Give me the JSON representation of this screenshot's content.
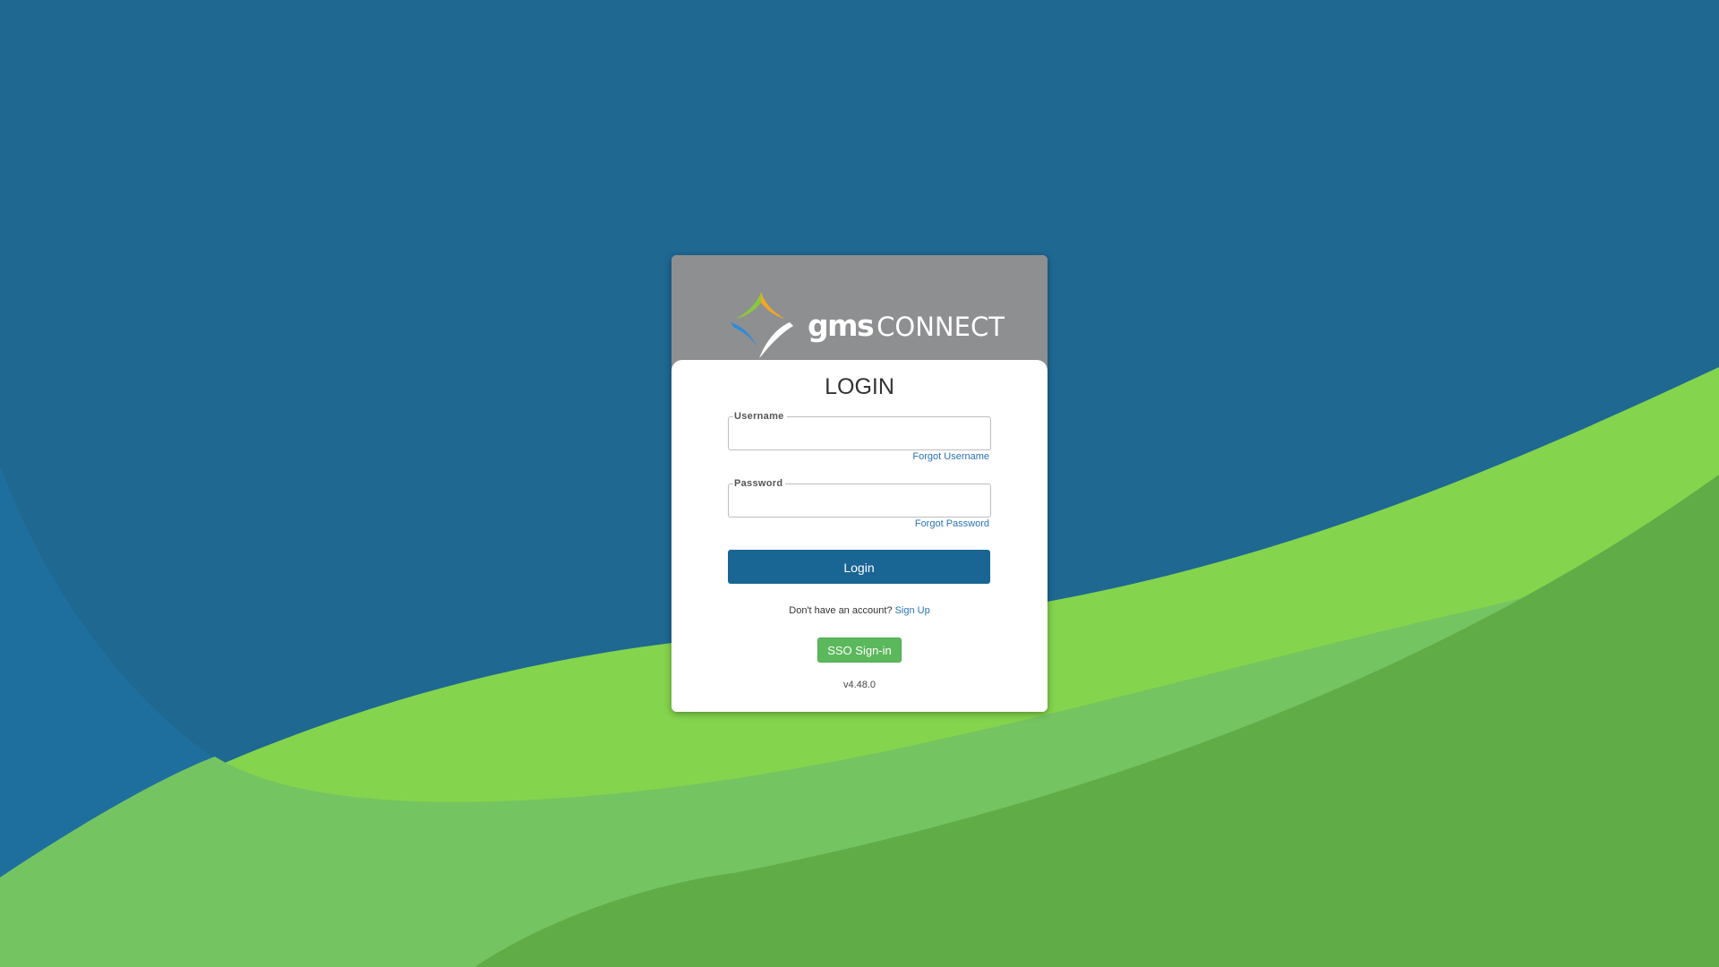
{
  "background": {
    "base_color": "#1e6892",
    "wave_colors": [
      "#1f6f9e",
      "#84d44e",
      "#74c461",
      "#60ac47"
    ]
  },
  "brand": {
    "logo_gms": "gms",
    "logo_connect": "CONNECT",
    "header_color": "#8e8f91",
    "logo_mark_colors": [
      "#f5a623",
      "#8cc63f",
      "#2e8ad8",
      "#ffffff"
    ]
  },
  "login": {
    "title": "LOGIN",
    "username": {
      "label": "Username",
      "value": "",
      "forgot_link": "Forgot Username"
    },
    "password": {
      "label": "Password",
      "value": "",
      "forgot_link": "Forgot Password"
    },
    "login_button": "Login",
    "signup_prompt": "Don't have an account?",
    "signup_link": "Sign Up",
    "sso_button": "SSO Sign-in",
    "version": "v4.48.0",
    "primary_color": "#196593",
    "sso_color": "#5cb85c",
    "link_color": "#2a73b5"
  }
}
